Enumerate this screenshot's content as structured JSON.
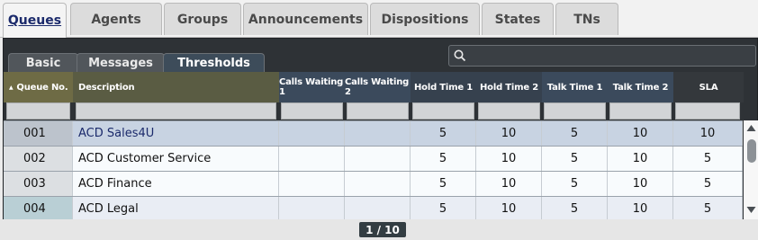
{
  "top_tabs": [
    "Queues",
    "Agents",
    "Groups",
    "Announcements",
    "Dispositions",
    "States",
    "TNs"
  ],
  "sub_tabs": [
    "Basic",
    "Messages",
    "Thresholds"
  ],
  "search": {
    "icon": "search-icon",
    "value": ""
  },
  "table": {
    "sort_indicator": "▲",
    "columns": [
      "Queue No.",
      "Description",
      "Calls Waiting 1",
      "Calls Waiting 2",
      "Hold Time 1",
      "Hold Time 2",
      "Talk Time 1",
      "Talk Time 2",
      "SLA"
    ],
    "rows": [
      {
        "queue_no": "001",
        "description": "ACD Sales4U",
        "calls_waiting_1": "",
        "calls_waiting_2": "",
        "hold_time_1": "5",
        "hold_time_2": "10",
        "talk_time_1": "5",
        "talk_time_2": "10",
        "sla": "10"
      },
      {
        "queue_no": "002",
        "description": "ACD Customer Service",
        "calls_waiting_1": "",
        "calls_waiting_2": "",
        "hold_time_1": "5",
        "hold_time_2": "10",
        "talk_time_1": "5",
        "talk_time_2": "10",
        "sla": "5"
      },
      {
        "queue_no": "003",
        "description": "ACD Finance",
        "calls_waiting_1": "",
        "calls_waiting_2": "",
        "hold_time_1": "5",
        "hold_time_2": "10",
        "talk_time_1": "5",
        "talk_time_2": "10",
        "sla": "5"
      },
      {
        "queue_no": "004",
        "description": "ACD Legal",
        "calls_waiting_1": "",
        "calls_waiting_2": "",
        "hold_time_1": "5",
        "hold_time_2": "10",
        "talk_time_1": "5",
        "talk_time_2": "10",
        "sla": "5"
      }
    ]
  },
  "pager": {
    "text": "1 / 10"
  },
  "colors": {
    "active_tab_text": "#1b2a6b",
    "header_dark": "#2e3236",
    "selected_row": "#c8d3e2"
  }
}
